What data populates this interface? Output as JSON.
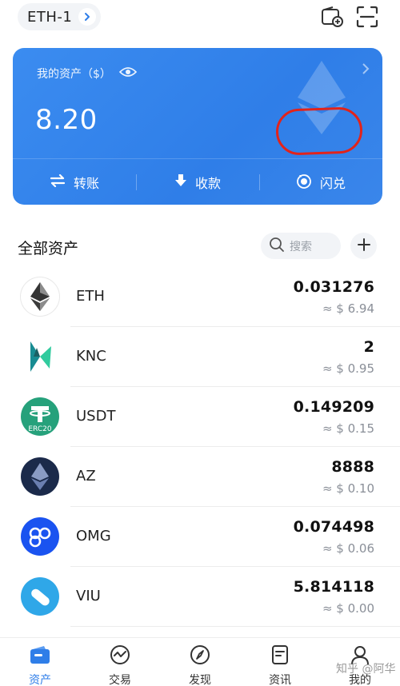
{
  "topbar": {
    "wallet_name": "ETH-1",
    "icons": [
      "wallet-add-icon",
      "scan-icon"
    ]
  },
  "card": {
    "label": "我的资产（$）",
    "amount": "8.20",
    "actions": [
      {
        "label": "转账",
        "icon": "transfer-icon"
      },
      {
        "label": "收款",
        "icon": "receive-icon"
      },
      {
        "label": "闪兑",
        "icon": "swap-icon"
      }
    ],
    "highlight_color": "#e2231a",
    "accent": "#2f7ee8"
  },
  "assets": {
    "title": "全部资产",
    "search_placeholder": "搜索"
  },
  "tokens": [
    {
      "symbol": "ETH",
      "balance": "0.031276",
      "value": "≈ $ 6.94",
      "color": "#ffffff"
    },
    {
      "symbol": "KNC",
      "balance": "2",
      "value": "≈ $ 0.95",
      "color": "#31cb9e"
    },
    {
      "symbol": "USDT",
      "balance": "0.149209",
      "value": "≈ $ 0.15",
      "color": "#26a17b",
      "badge": "ERC20"
    },
    {
      "symbol": "AZ",
      "balance": "8888",
      "value": "≈ $ 0.10",
      "color": "#1b2a4a"
    },
    {
      "symbol": "OMG",
      "balance": "0.074498",
      "value": "≈ $ 0.06",
      "color": "#1a53f0"
    },
    {
      "symbol": "VIU",
      "balance": "5.814118",
      "value": "≈ $ 0.00",
      "color": "#2fa7e8"
    }
  ],
  "nav": [
    {
      "label": "资产",
      "icon": "wallet-icon",
      "active": true
    },
    {
      "label": "交易",
      "icon": "trade-icon"
    },
    {
      "label": "发现",
      "icon": "compass-icon"
    },
    {
      "label": "资讯",
      "icon": "news-icon"
    },
    {
      "label": "我的",
      "icon": "profile-icon"
    }
  ],
  "watermark": "知乎 @阿华"
}
